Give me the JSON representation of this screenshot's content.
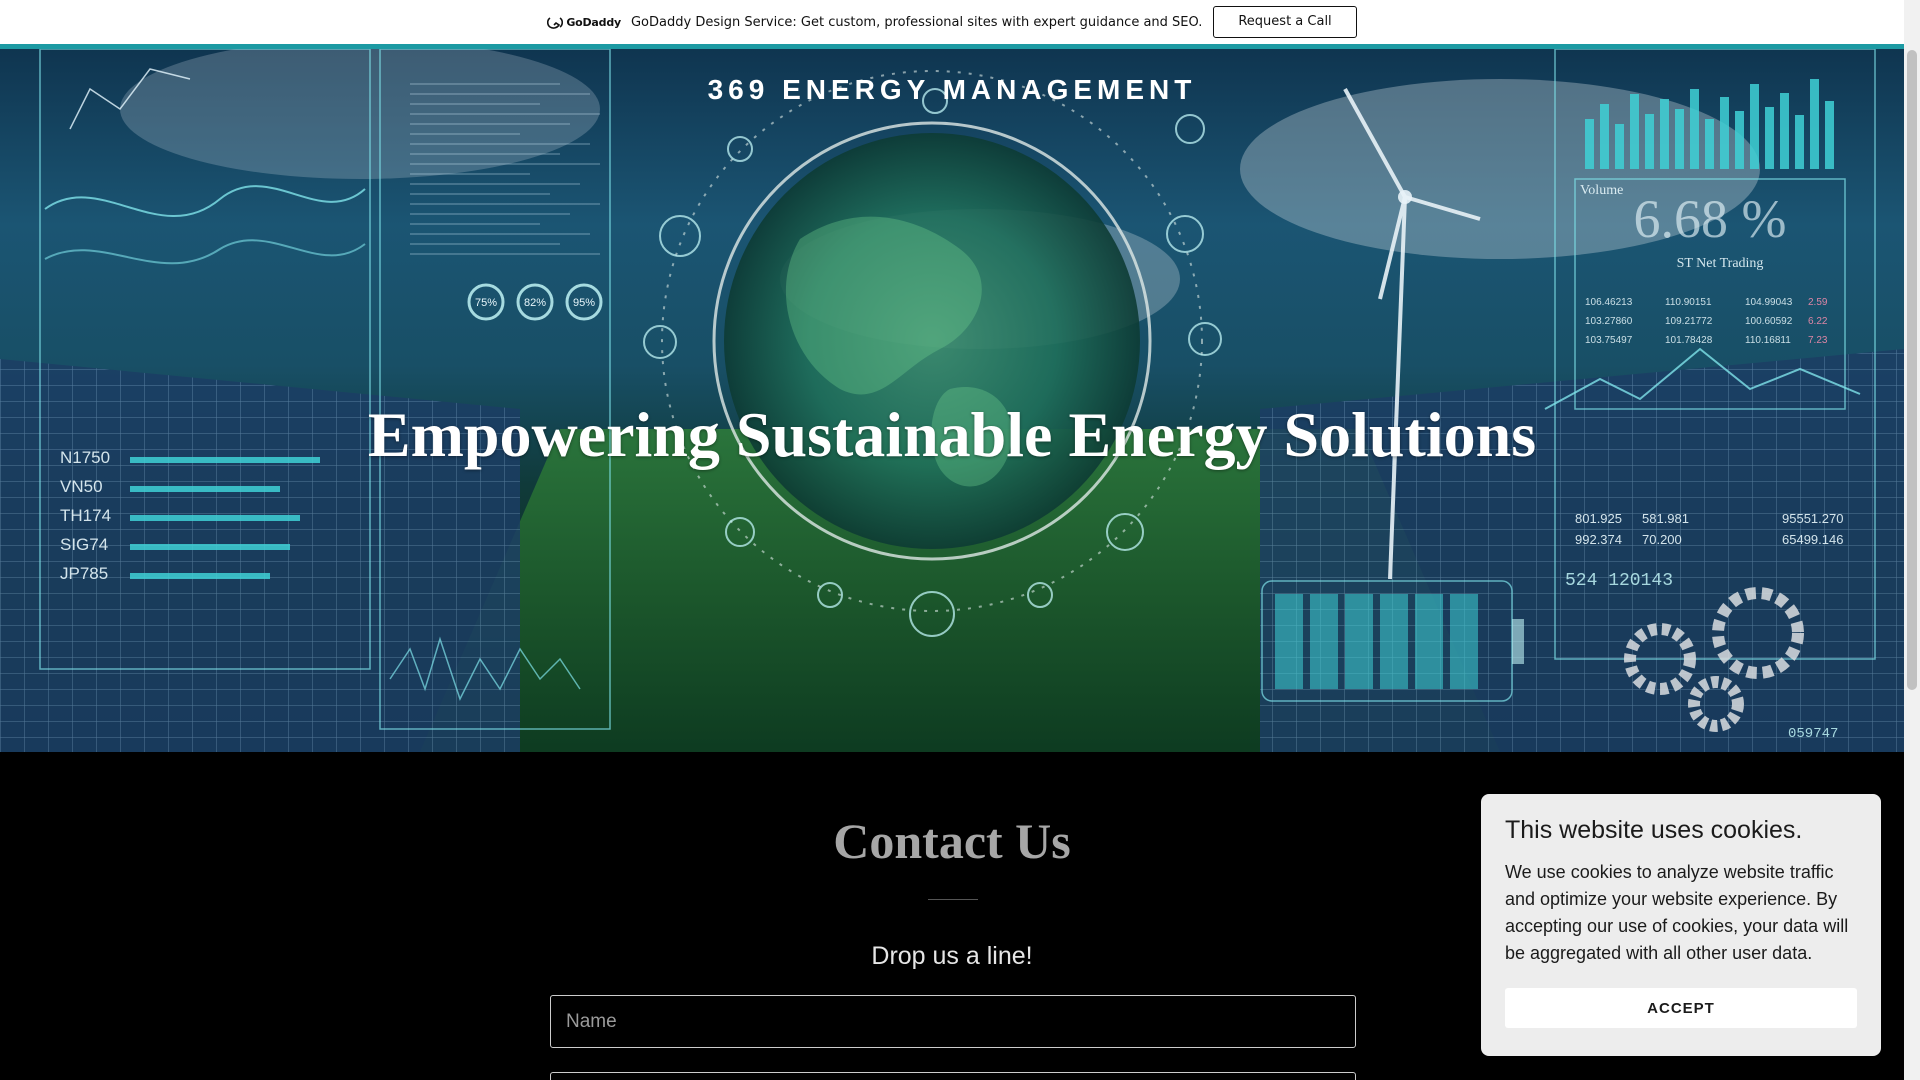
{
  "promo": {
    "logo_text": "GoDaddy",
    "message": "GoDaddy Design Service: Get custom, professional sites with expert guidance and SEO.",
    "cta_label": "Request a Call"
  },
  "hero": {
    "site_title": "369 ENERGY MANAGEMENT",
    "heading": "Empowering Sustainable Energy Solutions",
    "decor": {
      "volume_label": "Volume",
      "volume_value": "6.68 %",
      "trading_label": "ST Net Trading",
      "tickers": [
        "N1750",
        "VN50",
        "TH174",
        "SIG74",
        "JP785"
      ],
      "percents": [
        "75%",
        "82%",
        "95%"
      ],
      "trade_rows": [
        [
          "106.46213",
          "110.90151",
          "104.99043",
          "2.59"
        ],
        [
          "103.27860",
          "109.21772",
          "100.60592",
          "6.22"
        ],
        [
          "103.75497",
          "101.78428",
          "110.16811",
          "7.23"
        ]
      ],
      "stats": [
        "801.925",
        "581.981",
        "95551.270",
        "992.374",
        "70.200",
        "65499.146"
      ],
      "code_a": "524 120143",
      "code_b": "059747"
    }
  },
  "contact": {
    "title": "Contact Us",
    "subtitle": "Drop us a line!",
    "name_placeholder": "Name"
  },
  "cookie": {
    "title": "This website uses cookies.",
    "body": "We use cookies to analyze website traffic and optimize your website experience. By accepting our use of cookies, your data will be aggregated with all other user data.",
    "accept_label": "ACCEPT"
  },
  "colors": {
    "accent": "#1c9aa3",
    "cookie_bg": "#ededed",
    "page_bg": "#000000"
  }
}
